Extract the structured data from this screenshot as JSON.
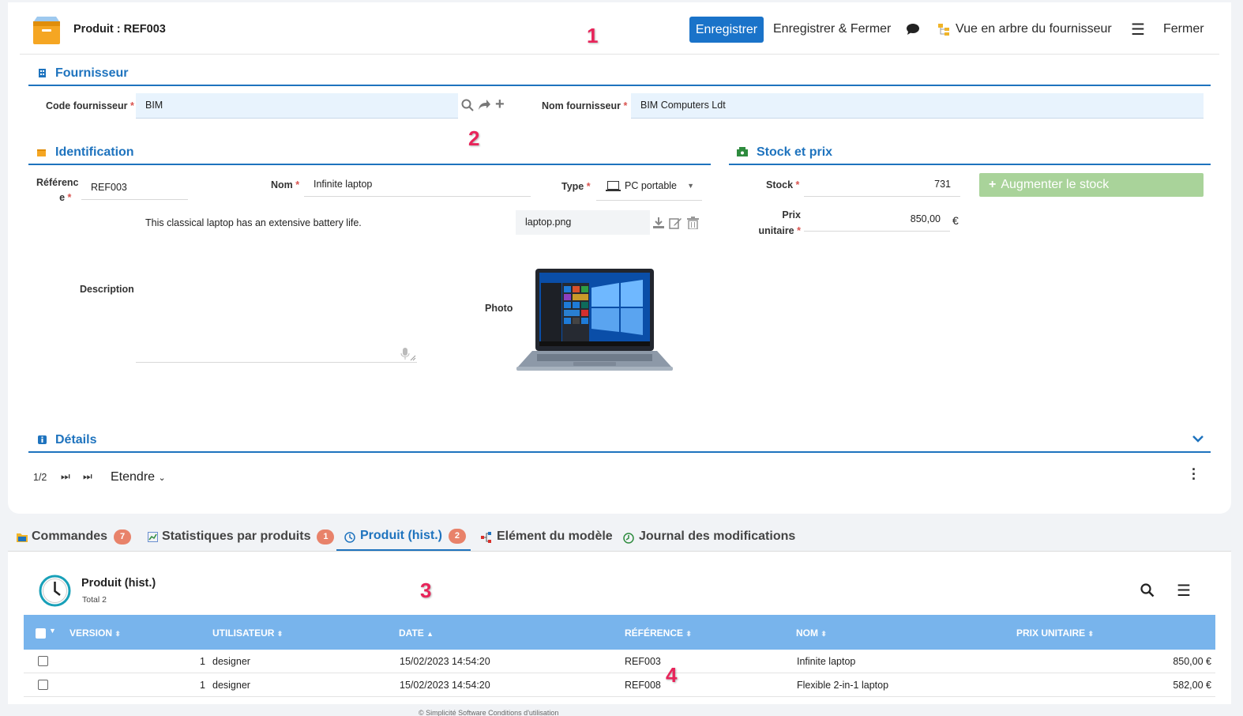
{
  "header": {
    "title": "Produit : REF003",
    "save_label": "Enregistrer",
    "save_close_label": "Enregistrer & Fermer",
    "tree_label": "Vue en arbre du fournisseur",
    "close_label": "Fermer"
  },
  "annotations": {
    "a1": "1",
    "a2": "2",
    "a3": "3",
    "a4": "4"
  },
  "supplier": {
    "title": "Fournisseur",
    "code_label": "Code fournisseur",
    "code_value": "BIM",
    "name_label": "Nom fournisseur",
    "name_value": "BIM Computers Ldt"
  },
  "identification": {
    "title": "Identification",
    "ref_label_1": "Référenc",
    "ref_label_2": "e",
    "ref_value": "REF003",
    "name_label": "Nom",
    "name_value": "Infinite laptop",
    "type_label": "Type",
    "type_value": "PC portable",
    "description_label": "Description",
    "description_value": "This classical laptop has an extensive battery life.",
    "photo_label": "Photo",
    "photo_file": "laptop.png"
  },
  "stock": {
    "title": "Stock et prix",
    "stock_label": "Stock",
    "stock_value": "731",
    "price_label_1": "Prix",
    "price_label_2": "unitaire",
    "price_value": "850,00",
    "currency": "€",
    "increase_label": "Augmenter le stock"
  },
  "details": {
    "title": "Détails"
  },
  "pager": {
    "position": "1/2",
    "expand_label": "Etendre"
  },
  "tabs": [
    {
      "label": "Commandes",
      "badge": "7"
    },
    {
      "label": "Statistiques par produits",
      "badge": "1"
    },
    {
      "label": "Produit (hist.)",
      "badge": "2"
    },
    {
      "label": "Elément du modèle"
    },
    {
      "label": "Journal des modifications"
    }
  ],
  "history": {
    "title": "Produit (hist.)",
    "total": "Total 2",
    "columns": [
      "VERSION",
      "UTILISATEUR",
      "DATE",
      "RÉFÉRENCE",
      "NOM",
      "PRIX UNITAIRE"
    ],
    "rows": [
      {
        "version": "1",
        "user": "designer",
        "date": "15/02/2023 14:54:20",
        "ref": "REF003",
        "name": "Infinite laptop",
        "price": "850,00 €"
      },
      {
        "version": "1",
        "user": "designer",
        "date": "15/02/2023 14:54:20",
        "ref": "REF008",
        "name": "Flexible 2-in-1 laptop",
        "price": "582,00 €"
      }
    ]
  },
  "footer": {
    "text": "© Simplicité Software     Conditions d'utilisation"
  },
  "colors": {
    "accent": "#1e73be",
    "primary_button": "#1a73c9",
    "grid_header": "#78b4ec",
    "badge": "#e8826a",
    "annotation": "#e8245a"
  }
}
